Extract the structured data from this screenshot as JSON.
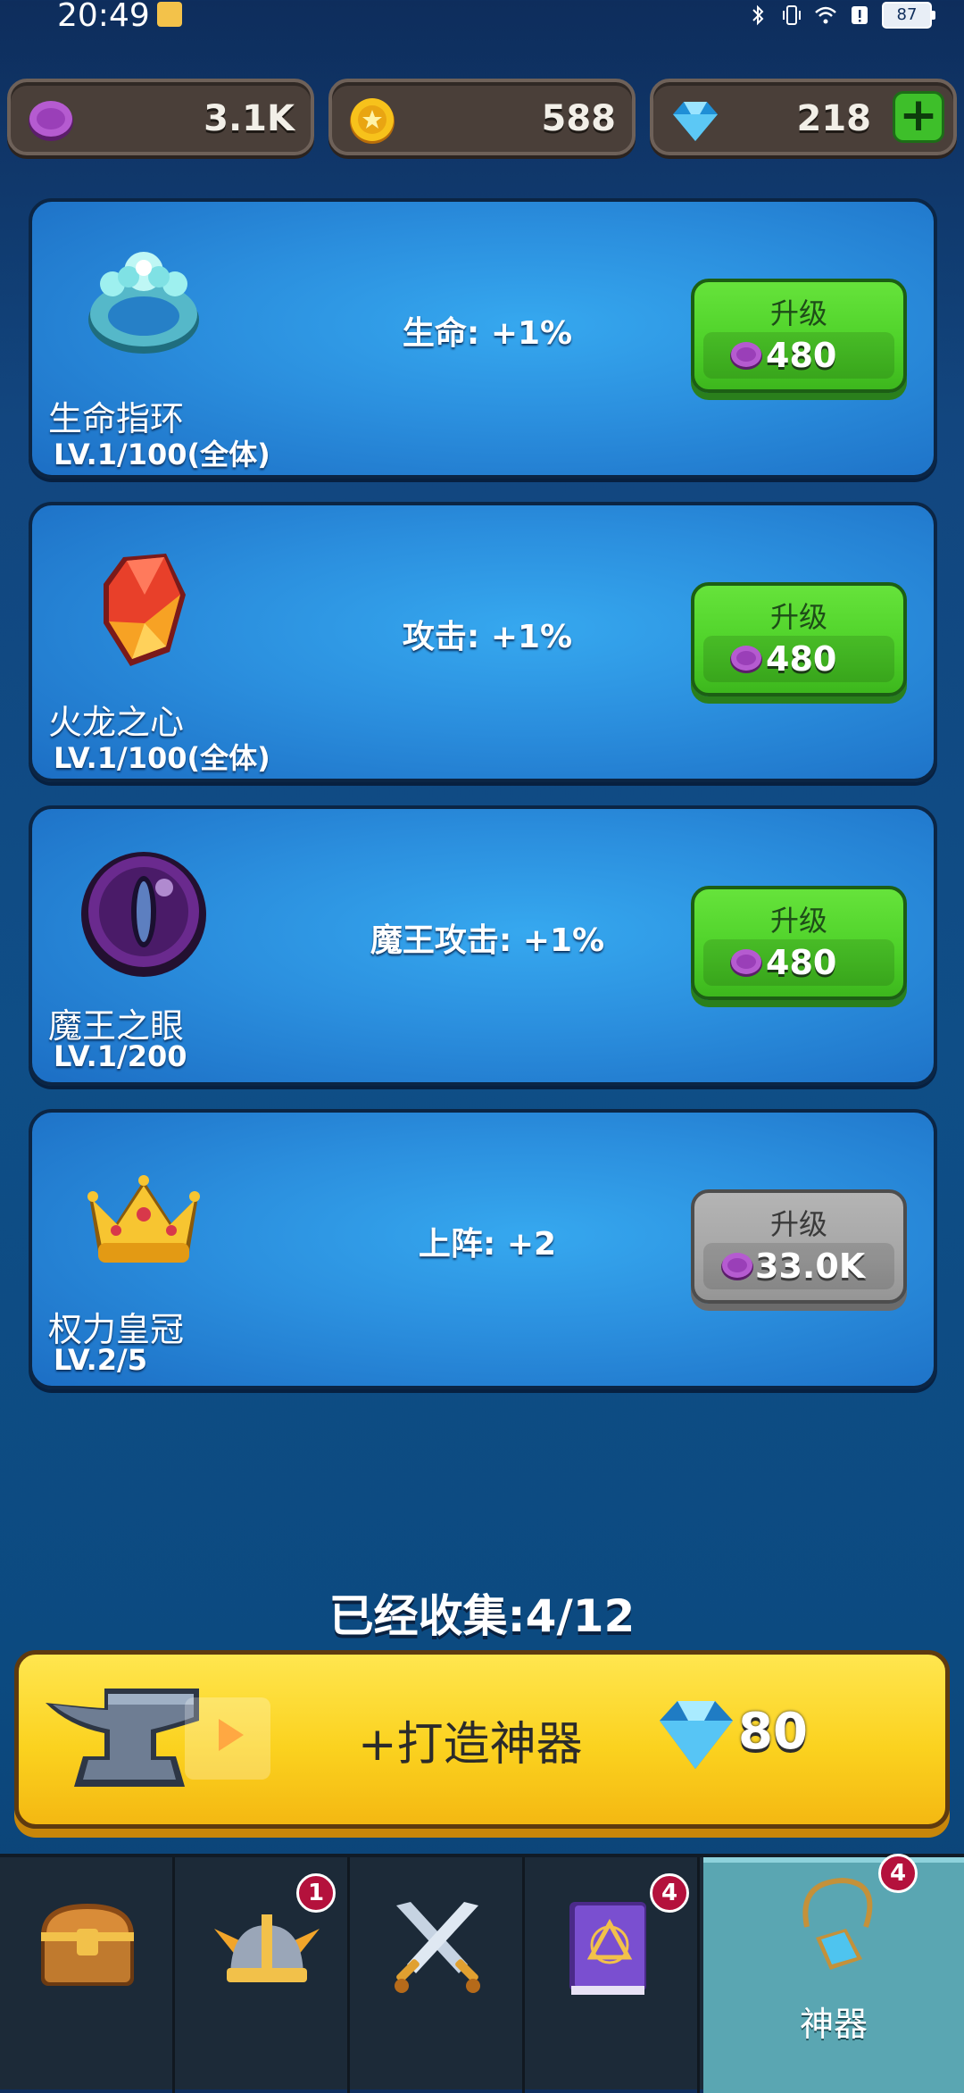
{
  "status_bar": {
    "time": "20:49",
    "battery": "87"
  },
  "currencies": [
    {
      "icon": "purple-coin-icon",
      "value": "3.1K"
    },
    {
      "icon": "gold-coin-icon",
      "value": "588"
    },
    {
      "icon": "diamond-icon",
      "value": "218",
      "action": "+"
    }
  ],
  "artifacts": [
    {
      "icon": "life-ring-icon",
      "name": "生命指环",
      "level": "LV.1/100(全体)",
      "effect": "生命: +1%",
      "upgrade_label": "升级",
      "cost": "480",
      "enabled": true
    },
    {
      "icon": "dragon-heart-gem-icon",
      "name": "火龙之心",
      "level": "LV.1/100(全体)",
      "effect": "攻击: +1%",
      "upgrade_label": "升级",
      "cost": "480",
      "enabled": true
    },
    {
      "icon": "demon-eye-icon",
      "name": "魔王之眼",
      "level": "LV.1/200",
      "effect": "魔王攻击: +1%",
      "upgrade_label": "升级",
      "cost": "480",
      "enabled": true
    },
    {
      "icon": "crown-icon",
      "name": "权力皇冠",
      "level": "LV.2/5",
      "effect": "上阵: +2",
      "upgrade_label": "升级",
      "cost": "33.0K",
      "enabled": false
    }
  ],
  "collected": {
    "label": "已经收集:4/12"
  },
  "forge": {
    "label": "+打造神器",
    "price": "80",
    "icon": "anvil-icon"
  },
  "bottom_nav": [
    {
      "icon": "treasure-chest-icon",
      "label": "",
      "badge": ""
    },
    {
      "icon": "winged-helmet-icon",
      "label": "",
      "badge": "1"
    },
    {
      "icon": "crossed-swords-icon",
      "label": "",
      "badge": ""
    },
    {
      "icon": "spellbook-icon",
      "label": "",
      "badge": "4"
    },
    {
      "icon": "amulet-icon",
      "label": "神器",
      "badge": "4",
      "active": true
    }
  ],
  "colors": {
    "background": "#12467f",
    "card": "#2b8fde",
    "upgrade_green": "#4fd22a",
    "upgrade_disabled": "#a6a6a6",
    "forge_yellow": "#fbd21f",
    "badge_red": "#b4113c",
    "nav_active": "#5aa6b2"
  }
}
